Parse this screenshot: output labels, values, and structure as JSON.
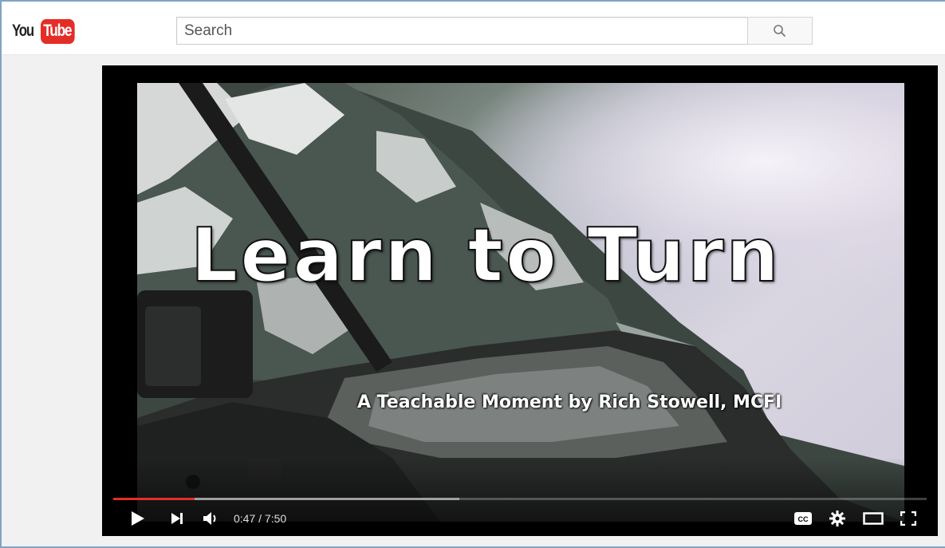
{
  "brand": {
    "you": "You",
    "tube": "Tube"
  },
  "search": {
    "placeholder": "Search",
    "value": ""
  },
  "icons": {
    "search": "search-icon",
    "play": "play-icon",
    "next": "next-icon",
    "volume": "volume-icon",
    "captions": "captions-icon",
    "settings": "gear-icon",
    "theater": "theater-mode-icon",
    "fullscreen": "fullscreen-icon"
  },
  "video": {
    "title_overlay": "Learn to Turn",
    "subtitle_overlay": "A Teachable Moment by Rich Stowell, MCFI"
  },
  "player": {
    "current_time": "0:47",
    "duration": "7:50",
    "time_display": "0:47 / 7:50",
    "played_fraction": 0.1,
    "loaded_fraction": 0.425,
    "captions_label": "CC"
  },
  "colors": {
    "brand_red": "#e52d27",
    "player_bg": "#000000",
    "page_bg": "#f1f1f1"
  }
}
